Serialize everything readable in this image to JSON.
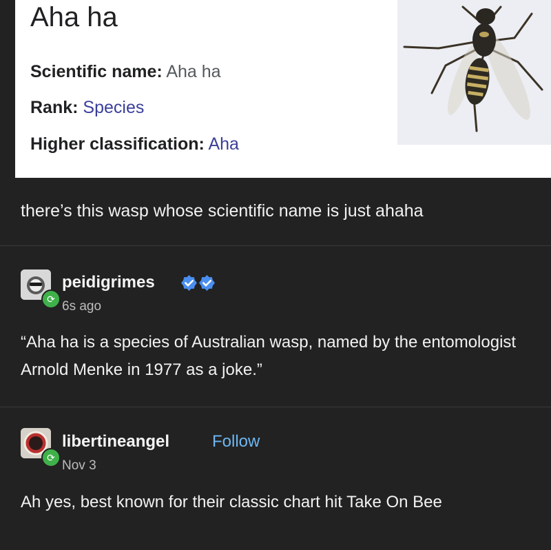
{
  "wiki": {
    "title": "Aha ha",
    "rows": [
      {
        "label": "Scientific name:",
        "value": "Aha ha"
      },
      {
        "label": "Rank:",
        "value": "Species"
      },
      {
        "label": "Higher classification:",
        "value": "Aha"
      }
    ]
  },
  "caption": "there’s this wasp whose scientific name is just ahaha",
  "posts": [
    {
      "username": "peidigrimes",
      "time": "6s ago",
      "text": "“Aha ha is a species of Australian wasp, named by the entomologist Arnold Menke in 1977 as a joke.”"
    },
    {
      "username": "libertineangel",
      "follow": "Follow",
      "time": "Nov 3",
      "text": "Ah yes, best known for their classic chart hit Take On Bee"
    }
  ],
  "colors": {
    "background": "#222222",
    "link_blue": "#3a3f9a",
    "follow_blue": "#6fb7f2",
    "reblog_green": "#3fb14a",
    "verified_blue": "#4a8ff0"
  }
}
